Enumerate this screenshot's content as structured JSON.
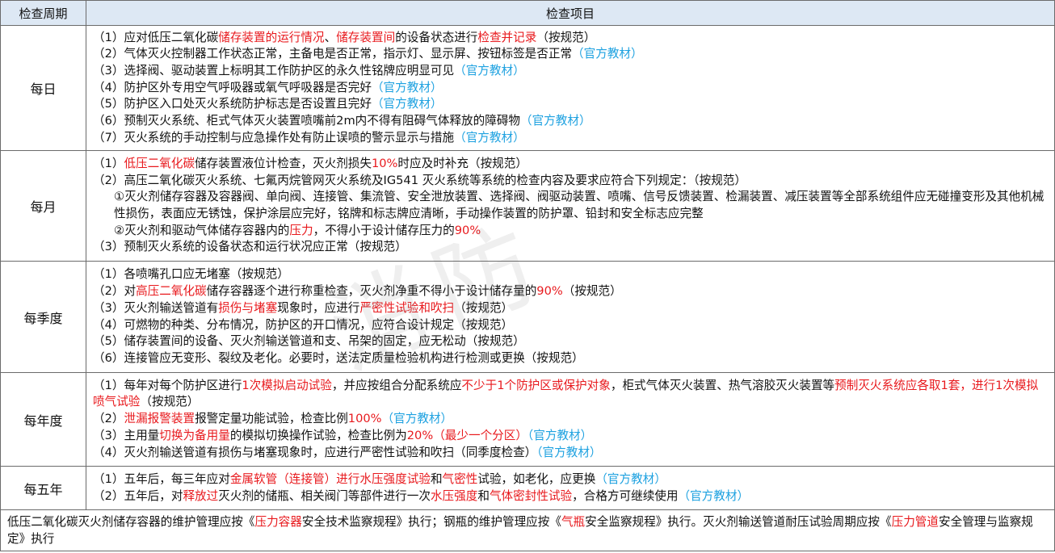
{
  "header": {
    "period": "检查周期",
    "items": "检查项目"
  },
  "sections": [
    {
      "period": "每日",
      "lines": [
        [
          [
            "（1）应对低压二氧化碳",
            ""
          ],
          [
            "储存装置的运行情况",
            "red"
          ],
          [
            "、",
            ""
          ],
          [
            "储存装置间",
            "red"
          ],
          [
            "的设备状态进行",
            ""
          ],
          [
            "检查并记录",
            "red"
          ],
          [
            "（按规范）",
            ""
          ]
        ],
        [
          [
            "（2）气体灭火控制器工作状态正常，主备电是否正常，指示灯、显示屏、按钮标签是否正常",
            ""
          ],
          [
            "（官方教材）",
            "blue"
          ]
        ],
        [
          [
            "（3）选择阀、驱动装置上标明其工作防护区的永久性铭牌应明显可见",
            ""
          ],
          [
            "（官方教材）",
            "blue"
          ]
        ],
        [
          [
            "（4）防护区外专用空气呼吸器或氧气呼吸器是否完好",
            ""
          ],
          [
            "（官方教材）",
            "blue"
          ]
        ],
        [
          [
            "（5）防护区入口处灭火系统防护标志是否设置且完好",
            ""
          ],
          [
            "（官方教材）",
            "blue"
          ]
        ],
        [
          [
            "（6）预制灭火系统、柜式气体灭火装置喷嘴前2m内不得有阻碍气体释放的障碍物",
            ""
          ],
          [
            "（官方教材）",
            "blue"
          ]
        ],
        [
          [
            "（7）灭火系统的手动控制与应急操作处有防止误喷的警示显示与措施",
            ""
          ],
          [
            "（官方教材）",
            "blue"
          ]
        ]
      ]
    },
    {
      "period": "每月",
      "lines": [
        [
          [
            "（1）",
            ""
          ],
          [
            "低压二氧化碳",
            "red"
          ],
          [
            "储存装置液位计检查，灭火剂损失",
            ""
          ],
          [
            "10%",
            "red"
          ],
          [
            "时应及时补充（按规范）",
            ""
          ]
        ],
        [
          [
            "（2）高压二氧化碳灭火系统、七氟丙烷管网灭火系统及IG541 灭火系统等系统的检查内容及要求应符合下列规定：（按规范）",
            ""
          ]
        ],
        [
          [
            "①灭火剂储存容器及容器阀、单向阀、连接管、集流管、安全泄放装置、选择阀、阀驱动装置、喷嘴、信号反馈装置、检漏装置、减压装置等全部系统组件应无碰撞变形及其他机械性损伤，表面应无锈蚀，保护涂层应完好，铭牌和标志牌应清晰，手动操作装置的防护罩、铅封和安全标志应完整",
            ""
          ]
        ],
        [
          [
            "②灭火剂和驱动气体储存容器内的",
            ""
          ],
          [
            "压力",
            "red"
          ],
          [
            "，不得小于设计储存压力的",
            ""
          ],
          [
            "90%",
            "red"
          ]
        ],
        [
          [
            "（3）预制灭火系统的设备状态和运行状况应正常（按规范）",
            ""
          ]
        ]
      ]
    },
    {
      "period": "每季度",
      "lines": [
        [
          [
            "（1）各喷嘴孔口应无堵塞（按规范）",
            ""
          ]
        ],
        [
          [
            "（2）对",
            ""
          ],
          [
            "高压二氧化碳",
            "red"
          ],
          [
            "储存容器逐个进行称重检查，灭火剂净重不得小于设计储存量的",
            ""
          ],
          [
            "90%",
            "red"
          ],
          [
            "（按规范）",
            ""
          ]
        ],
        [
          [
            "（3）灭火剂输送管道有",
            ""
          ],
          [
            "损伤与堵塞",
            "red"
          ],
          [
            "现象时，应进行",
            ""
          ],
          [
            "严密性试验和吹扫",
            "red"
          ],
          [
            "（按规范）",
            ""
          ]
        ],
        [
          [
            "（4）可燃物的种类、分布情况，防护区的开口情况，应符合设计规定（按规范）",
            ""
          ]
        ],
        [
          [
            "（5）储存装置间的设备、灭火剂输送管道和支、吊架的固定，应无松动（按规范）",
            ""
          ]
        ],
        [
          [
            "（6）连接管应无变形、裂纹及老化。必要时，送法定质量检验机构进行检测或更换（按规范）",
            ""
          ]
        ]
      ]
    },
    {
      "period": "每年度",
      "lines": [
        [
          [
            "（1）每年对每个防护区进行",
            ""
          ],
          [
            "1次模拟启动试验",
            "red"
          ],
          [
            "，并应按组合分配系统应",
            ""
          ],
          [
            "不少于1个防护区或保护对象",
            "red"
          ],
          [
            "，柜式气体灭火装置、热气溶胶灭火装置等",
            ""
          ],
          [
            "预制灭火系统应各取1套，进行1次模拟喷气试验",
            "red"
          ],
          [
            "（按规范）",
            ""
          ]
        ],
        [
          [
            "（2）",
            ""
          ],
          [
            "泄漏报警装置",
            "red"
          ],
          [
            "报警定量功能试验，检查比例",
            ""
          ],
          [
            "100%",
            "red"
          ],
          [
            "（官方教材）",
            "blue"
          ]
        ],
        [
          [
            "（3）主用量",
            ""
          ],
          [
            "切换为备用量",
            "red"
          ],
          [
            "的模拟切换操作试验，检查比例为",
            ""
          ],
          [
            "20%（最少一个分区）",
            "red"
          ],
          [
            "（官方教材）",
            "blue"
          ]
        ],
        [
          [
            "（4）灭火剂输送管道有损伤与堵塞现象时，应进行严密性试验和吹扫（同季度检查）",
            ""
          ],
          [
            "（官方教材）",
            "blue"
          ]
        ]
      ]
    },
    {
      "period": "每五年",
      "lines": [
        [
          [
            "（1）五年后，每三年应对",
            ""
          ],
          [
            "金属软管（连接管）进行水压强度试验",
            "red"
          ],
          [
            "和",
            ""
          ],
          [
            "气密性",
            "red"
          ],
          [
            "试验，如老化，应更换",
            ""
          ],
          [
            "（官方教材）",
            "blue"
          ]
        ],
        [
          [
            "（2）五年后，对",
            ""
          ],
          [
            "释放过",
            "red"
          ],
          [
            "灭火剂的储瓶、相关阀门等部件进行一次",
            ""
          ],
          [
            "水压强度",
            "red"
          ],
          [
            "和",
            ""
          ],
          [
            "气体密封性试验",
            "red"
          ],
          [
            "，合格方可继续使用",
            ""
          ],
          [
            "（官方教材）",
            "blue"
          ]
        ]
      ]
    }
  ],
  "note": [
    [
      "低压二氧化碳灭火剂储存容器的维护管理应按《",
      ""
    ],
    [
      "压力容器",
      "red"
    ],
    [
      "安全技术监察规程》执行；钢瓶的维护管理应按《",
      ""
    ],
    [
      "气瓶",
      "red"
    ],
    [
      "安全监察规程》执行。灭火剂输送管道耐压试验周期应按《",
      ""
    ],
    [
      "压力管道",
      "red"
    ],
    [
      "安全管理与监察规定》执行",
      ""
    ]
  ]
}
